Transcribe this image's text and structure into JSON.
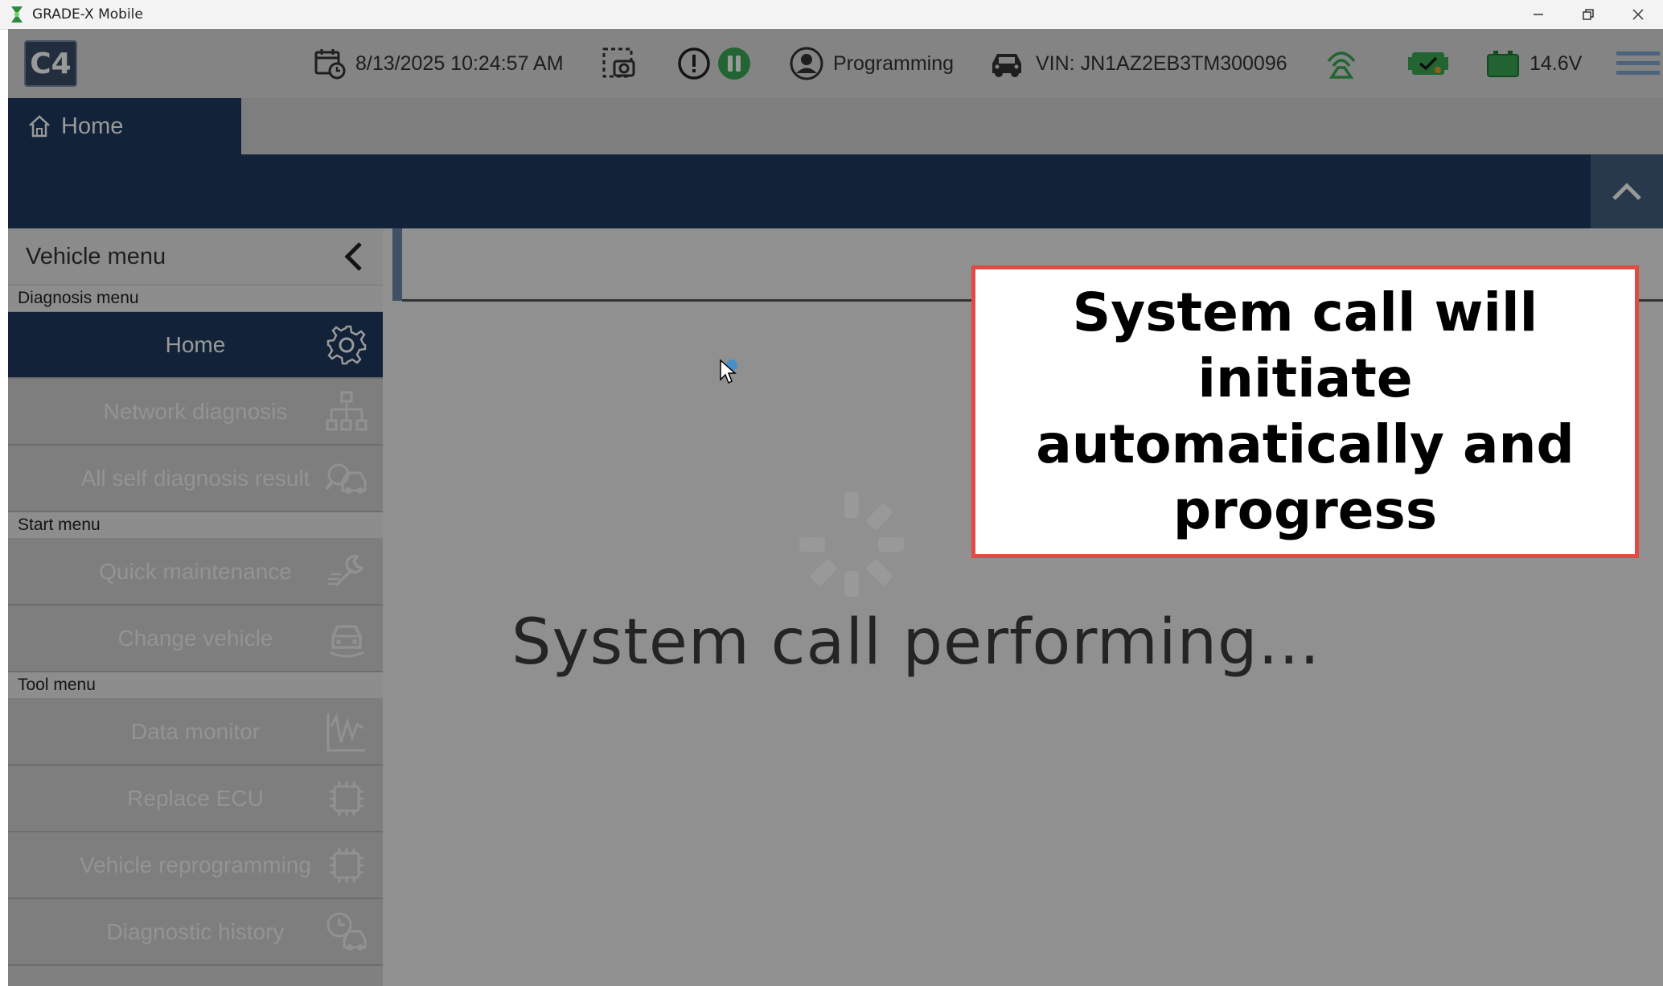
{
  "window": {
    "title": "GRADE-X Mobile",
    "buttons": [
      {
        "name": "minimize-icon"
      },
      {
        "name": "restore-icon"
      },
      {
        "name": "close-icon"
      }
    ]
  },
  "topbar": {
    "logo_text": "C4",
    "datetime": "8/13/2025 10:24:57 AM",
    "user_mode": "Programming",
    "vin": "VIN: JN1AZ2EB3TM300096",
    "voltage": "14.6V",
    "status_colors": {
      "ok_green": "#3aa856",
      "warning_orange": "#f0a020"
    }
  },
  "tab": {
    "home_label": "Home"
  },
  "sidebar": {
    "title": "Vehicle menu",
    "sections": [
      {
        "label": "Diagnosis menu",
        "items": [
          {
            "label": "Home",
            "icon": "gear-icon",
            "active": true
          },
          {
            "label": "Network diagnosis",
            "icon": "network-icon"
          },
          {
            "label": "All self diagnosis result",
            "icon": "car-search-icon"
          }
        ]
      },
      {
        "label": "Start menu",
        "items": [
          {
            "label": "Quick maintenance",
            "icon": "wrench-icon"
          },
          {
            "label": "Change vehicle",
            "icon": "car-swap-icon"
          }
        ]
      },
      {
        "label": "Tool menu",
        "items": [
          {
            "label": "Data monitor",
            "icon": "chart-icon"
          },
          {
            "label": "Replace ECU",
            "icon": "chip-icon"
          },
          {
            "label": "Vehicle reprogramming",
            "icon": "chip-icon"
          },
          {
            "label": "Diagnostic history",
            "icon": "history-icon"
          }
        ]
      }
    ]
  },
  "main": {
    "loading_text": "System call performing..."
  },
  "callout": {
    "text": "System call will initiate automatically and progress",
    "border_color": "#e24b43"
  },
  "colors": {
    "navy": "#1f3a5f",
    "active_item": "#1f3a5f"
  }
}
